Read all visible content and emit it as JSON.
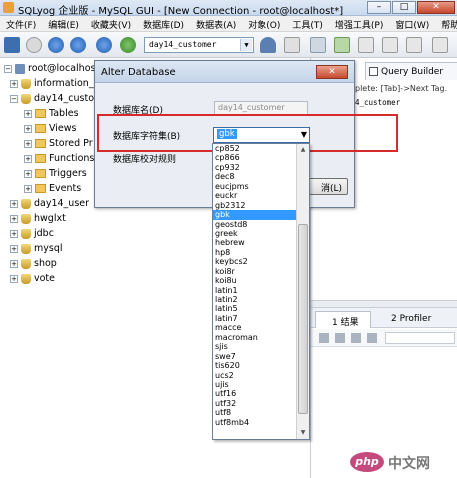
{
  "window": {
    "title": "SQLyog 企业版 - MySQL GUI - [New Connection - root@localhost*]",
    "minimize": "–",
    "maximize": "□",
    "close": "✕"
  },
  "menubar": {
    "items": [
      "文件(F)",
      "编辑(E)",
      "收藏夹(V)",
      "数据库(D)",
      "数据表(A)",
      "对象(O)",
      "工具(T)",
      "增强工具(P)",
      "窗口(W)",
      "帮助(H)"
    ]
  },
  "toolbar": {
    "database_select": "day14_customer",
    "select_arrow": "▼"
  },
  "tree": {
    "server": "root@localhost",
    "databases": [
      {
        "name": "information_s",
        "expanded": false
      },
      {
        "name": "day14_custom",
        "expanded": true
      },
      {
        "name": "day14_user",
        "expanded": false
      },
      {
        "name": "hwglxt",
        "expanded": false
      },
      {
        "name": "jdbc",
        "expanded": false
      },
      {
        "name": "mysql",
        "expanded": false
      },
      {
        "name": "shop",
        "expanded": false
      },
      {
        "name": "vote",
        "expanded": false
      }
    ],
    "folders": [
      "Tables",
      "Views",
      "Stored Pr",
      "Functions",
      "Triggers",
      "Events"
    ],
    "toggle_expand": "+",
    "toggle_collapse": "−"
  },
  "right_panel": {
    "query_builder_tab": "Query Builder",
    "hint": "plete: [Tab]->Next Tag.",
    "editor_line": "4_customer",
    "result_tab_num": "1",
    "result_tab": "结果",
    "profiler_tab_num": "2",
    "profiler_tab": "Profiler"
  },
  "dialog": {
    "title": "Alter Database",
    "close": "✕",
    "db_name_label": "数据库名(D)",
    "db_name_value": "day14_customer",
    "charset_label": "数据库字符集(B)",
    "charset_value": "gbk",
    "collation_label": "数据库校对规则",
    "cancel_label": "消(L)"
  },
  "charset_options": [
    "cp852",
    "cp866",
    "cp932",
    "dec8",
    "eucjpms",
    "euckr",
    "gb2312",
    "gbk",
    "geostd8",
    "greek",
    "hebrew",
    "hp8",
    "keybcs2",
    "koi8r",
    "koi8u",
    "latin1",
    "latin2",
    "latin5",
    "latin7",
    "macce",
    "macroman",
    "sjis",
    "swe7",
    "tis620",
    "ucs2",
    "ujis",
    "utf16",
    "utf32",
    "utf8",
    "utf8mb4"
  ],
  "selected_charset": "gbk",
  "watermark": {
    "logo": "php",
    "text": "中文网"
  },
  "colors": {
    "highlight": "#3399ff",
    "annotation_box": "#d52b2b",
    "title_bar": "#c9d9ee"
  }
}
